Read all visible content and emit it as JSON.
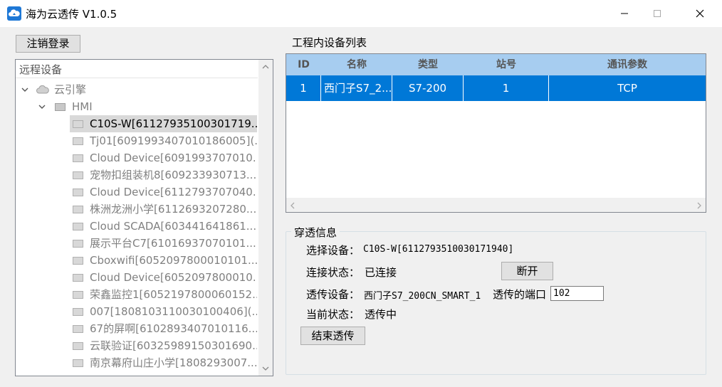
{
  "window": {
    "title": "海为云透传 V1.0.5",
    "accent": "#0078d7"
  },
  "logout_button": "注销登录",
  "tree": {
    "header": "远程设备",
    "root": "云引擎",
    "group": "HMI",
    "devices": [
      "C10S-W[61127935100301719...",
      "Tj01[6091993407010186005](...",
      "Cloud Device[6091993707010...",
      "宠物扣组装机8[609233930713...",
      "Cloud Device[6112793707040...",
      "株洲龙洲小学[611269320728​0...",
      "Cloud SCADA[603441641861...",
      "展示平台C7[61016937070101...",
      "Cboxwifi[605209780001010​1...",
      "Cloud Device[6052097800010...",
      "荣鑫监控1[6052197800060152...",
      "007[1808103110030100406](...",
      "67的屏啊[6102893407010116...",
      "云联验证[60325989150301690...",
      "南京幕府山庄小学[1808293007..."
    ],
    "selected_index": 0
  },
  "device_list": {
    "title": "工程内设备列表",
    "columns": [
      "ID",
      "名称",
      "类型",
      "站号",
      "通讯参数"
    ],
    "rows": [
      {
        "id": "1",
        "name": "西门子S7_2...",
        "type": "S7-200",
        "station": "1",
        "params": "TCP"
      }
    ]
  },
  "info": {
    "title": "穿透信息",
    "select_device_label": "选择设备：",
    "select_device_value": "C10S-W[61127935100301719​40]",
    "conn_status_label": "连接状态：",
    "conn_status_value": "已连接",
    "disconnect_button": "断开",
    "pass_device_label": "透传设备：",
    "pass_device_value": "西门子S7_200CN_SMART_1",
    "port_label": "透传的端口",
    "port_value": "102",
    "current_status_label": "当前状态：",
    "current_status_value": "透传中",
    "end_button": "结束透传"
  }
}
